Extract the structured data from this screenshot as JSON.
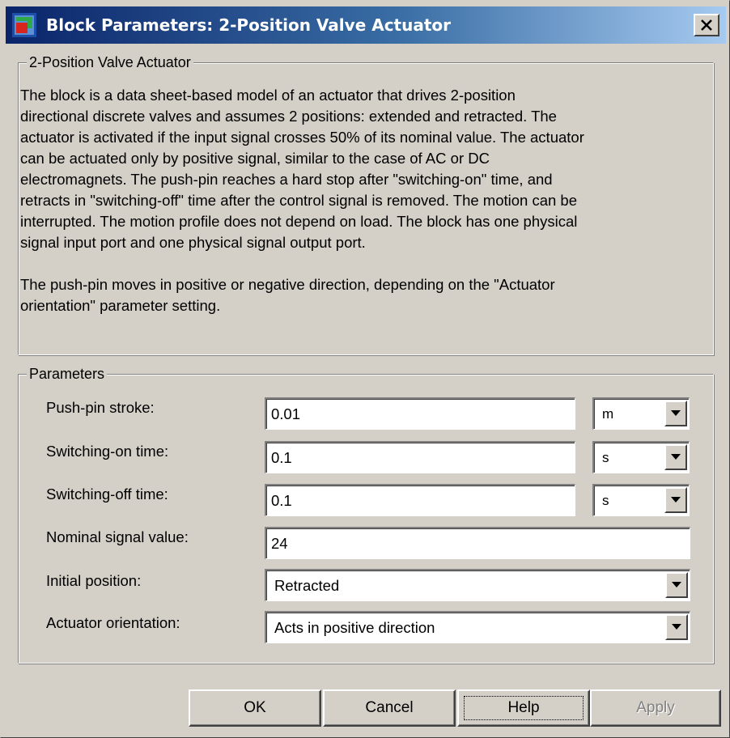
{
  "window": {
    "title": "Block Parameters: 2-Position Valve Actuator",
    "title_bar_color": "#0a246a",
    "close_icon": "close-x-icon"
  },
  "description_group": {
    "legend": "2-Position Valve Actuator",
    "lines": [
      "The block is a data sheet-based model of an actuator that drives 2-position",
      "directional discrete valves and assumes 2 positions: extended and retracted. The",
      "actuator is activated if the input signal crosses 50% of its nominal value. The actuator",
      "can be actuated only by positive signal, similar to the case of AC or DC",
      "electromagnets. The push-pin reaches a hard stop after \"switching-on\" time, and",
      "retracts in \"switching-off\" time after the control signal is removed. The motion can be",
      "interrupted. The motion profile does not depend on load. The block has one physical",
      "signal input port and one physical signal output port.",
      "",
      "The push-pin moves in positive or negative direction, depending on the \"Actuator",
      "orientation\" parameter setting."
    ]
  },
  "parameters_group": {
    "legend": "Parameters",
    "stroke": {
      "label": "Push-pin stroke:",
      "value": "0.01",
      "unit": "m"
    },
    "switch_on": {
      "label": "Switching-on time:",
      "value": "0.1",
      "unit": "s"
    },
    "switch_off": {
      "label": "Switching-off time:",
      "value": "0.1",
      "unit": "s"
    },
    "nominal": {
      "label": "Nominal signal value:",
      "value": "24"
    },
    "initial_position": {
      "label": "Initial position:",
      "value": "Retracted"
    },
    "orientation": {
      "label": "Actuator orientation:",
      "value": "Acts in positive direction"
    }
  },
  "buttons": {
    "ok": "OK",
    "cancel": "Cancel",
    "help": "Help",
    "apply": "Apply"
  }
}
